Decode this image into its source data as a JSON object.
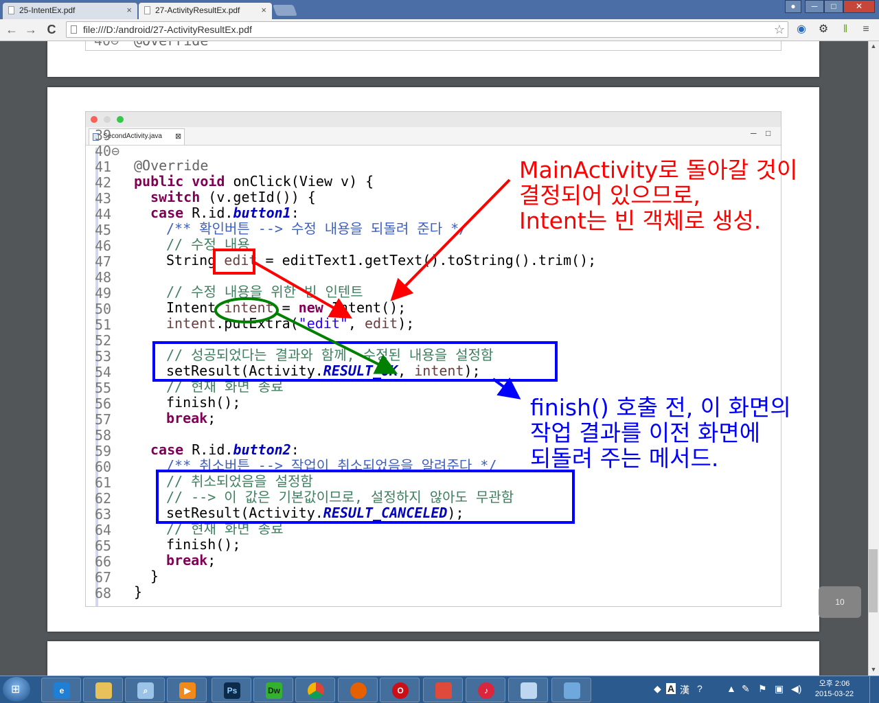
{
  "browser": {
    "tabs": [
      {
        "label": "25-IntentEx.pdf",
        "active": false
      },
      {
        "label": "27-ActivityResultEx.pdf",
        "active": true
      }
    ],
    "tab_close": "×",
    "url": "file:///D:/android/27-ActivityResultEx.pdf",
    "nav": {
      "back": "←",
      "forward": "→",
      "reload": "C"
    },
    "star": "☆",
    "window_controls": {
      "minimize": "─",
      "maximize": "□",
      "close": "✕"
    }
  },
  "pdf": {
    "prev_page_line_number": "40⊖",
    "prev_page_code": "@Override",
    "page_badge": "10"
  },
  "editor": {
    "tab_label": "SecondActivity.java",
    "tab_close": "⊠",
    "view_controls": {
      "minimize": "─",
      "maximize": "□"
    },
    "line_numbers": [
      "39",
      "40⊖",
      "41",
      "42",
      "43",
      "44",
      "45",
      "46",
      "47",
      "48",
      "49",
      "50",
      "51",
      "52",
      "53",
      "54",
      "55",
      "56",
      "57",
      "58",
      "59",
      "60",
      "61",
      "62",
      "63",
      "64",
      "65",
      "66",
      "67",
      "68"
    ],
    "code": {
      "l40": "@Override",
      "l41_kw": "public void",
      "l41_rest": " onClick(View v) {",
      "l42_kw": "switch",
      "l42_rest": " (v.getId()) {",
      "l43_kw": "case",
      "l43_mid": " R.id.",
      "l43_fld": "button1",
      "l43_end": ":",
      "l44": "/** 확인버튼 --> 수정 내용을 되돌려 준다 */",
      "l45": "// 수정 내용",
      "l46_a": "String ",
      "l46_var": "edit",
      "l46_b": " = editText1.getText().toString().trim();",
      "l48": "// 수정 내용을 위한 빈 인텐트",
      "l49_a": "Intent ",
      "l49_var": "intent",
      "l49_b": " = ",
      "l49_kw": "new",
      "l49_c": " Intent();",
      "l50_var": "intent",
      "l50_a": ".putExtra(",
      "l50_str": "\"edit\"",
      "l50_b": ", ",
      "l50_var2": "edit",
      "l50_c": ");",
      "l52": "// 성공되었다는 결과와 함께, 수정된 내용을 설정함",
      "l53_a": "setResult(Activity.",
      "l53_fld": "RESULT_OK",
      "l53_b": ", ",
      "l53_var": "intent",
      "l53_c": ");",
      "l54": "// 현재 화면 종료",
      "l55": "finish();",
      "l56_kw": "break",
      "l56_end": ";",
      "l58_kw": "case",
      "l58_mid": " R.id.",
      "l58_fld": "button2",
      "l58_end": ":",
      "l59": "/** 취소버튼 --> 작업이 취소되었음을 알려준다 */",
      "l60": "// 취소되었음을 설정함",
      "l61": "// --> 이 값은 기본값이므로, 설정하지 않아도 무관함",
      "l62_a": "setResult(Activity.",
      "l62_fld": "RESULT_CANCELED",
      "l62_b": ");",
      "l63": "// 현재 화면 종료",
      "l64": "finish();",
      "l65_kw": "break",
      "l65_end": ";",
      "l66": "}",
      "l67": "}"
    }
  },
  "annotations": {
    "red_note": "MainActivity로 돌아갈 것이\n결정되어 있으므로,\nIntent는 빈 객체로 생성.",
    "blue_note": "finish() 호출 전, 이 화면의\n작업 결과를 이전 화면에\n되돌려 주는 메서드."
  },
  "colors": {
    "annotation_red": "#ff0000",
    "annotation_blue": "#0000ff",
    "annotation_green": "#008000"
  },
  "taskbar": {
    "apps": [
      "internet-explorer",
      "file-explorer",
      "search-tool",
      "media-player",
      "photoshop",
      "dreamweaver",
      "chrome",
      "firefox",
      "opera",
      "paint",
      "itunes",
      "notepad",
      "photo-viewer"
    ],
    "app_labels": {
      "photoshop": "Ps",
      "dreamweaver": "Dw"
    },
    "ime_mode": "A",
    "ime_hanja": "漢",
    "clock_time": "오후 2:06",
    "clock_date": "2015-03-22"
  }
}
